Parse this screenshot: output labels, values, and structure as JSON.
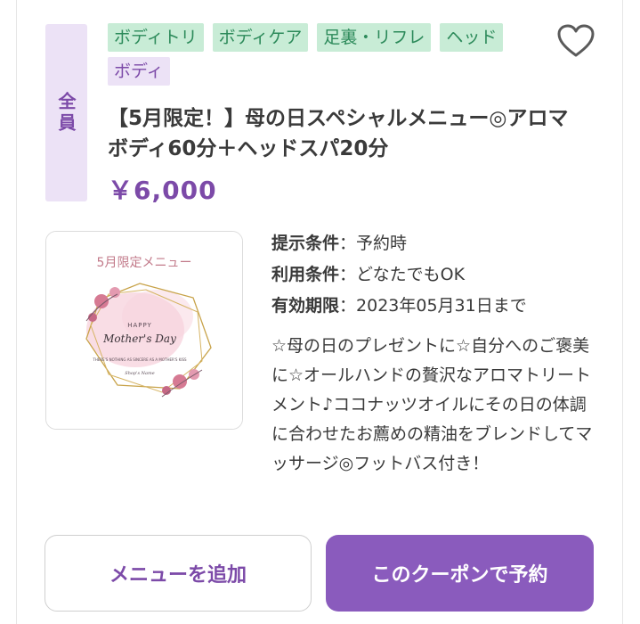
{
  "coupon": {
    "scope_label": "全員",
    "tags": [
      {
        "label": "ボディトリ",
        "variant": "green"
      },
      {
        "label": "ボディケア",
        "variant": "green"
      },
      {
        "label": "足裏・リフレ",
        "variant": "green"
      },
      {
        "label": "ヘッド",
        "variant": "green"
      },
      {
        "label": "ボディ",
        "variant": "purple"
      }
    ],
    "title": "【5月限定！】母の日スペシャルメニュー◎アロマボディ60分＋ヘッドスパ20分",
    "price": "￥6,000",
    "image": {
      "header": "5月限定メニュー",
      "happy": "HAPPY",
      "mothers_day": "Mother's Day",
      "quote": "THERE'S NOTHING AS SINCERE AS A MOTHER'S KISS",
      "signature": "Shop's Name"
    },
    "conditions": [
      {
        "key": "提示条件",
        "value": "予約時"
      },
      {
        "key": "利用条件",
        "value": "どなたでもOK"
      },
      {
        "key": "有効期限",
        "value": "2023年05月31日まで"
      }
    ],
    "separator": "：",
    "description": "☆母の日のプレゼントに☆自分へのご褒美に☆オールハンドの贅沢なアロマトリートメント♪ココナッツオイルにその日の体調に合わせたお薦めの精油をブレンドしてマッサージ◎フットバス付き！"
  },
  "buttons": {
    "add_menu": "メニューを追加",
    "reserve": "このクーポンで予約"
  },
  "icons": {
    "favorite": "heart-outline-icon"
  },
  "colors": {
    "accent_purple": "#8a5bbd",
    "tag_green_bg": "#c8ecd6",
    "tag_purple_bg": "#ece2f6"
  }
}
